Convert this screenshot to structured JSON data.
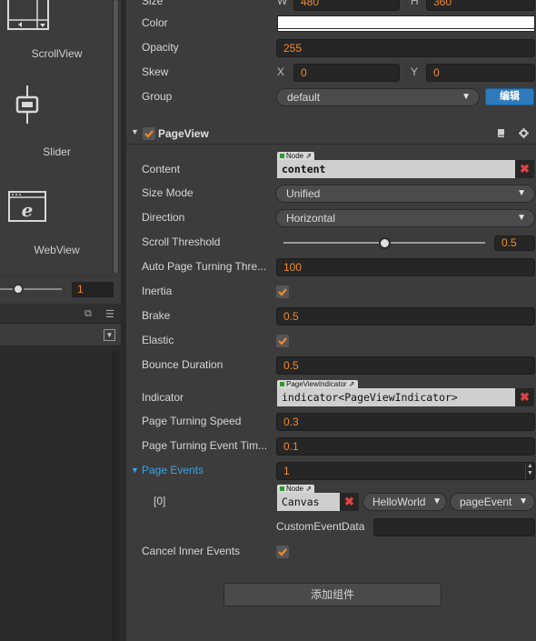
{
  "library": {
    "items": [
      {
        "label": "ScrollView",
        "icon": "scrollview-icon"
      },
      {
        "label": "Slider",
        "icon": "slider-icon"
      },
      {
        "label": "WebView",
        "icon": "webview-icon"
      }
    ],
    "zoom_value": "1"
  },
  "inspector": {
    "size": {
      "label": "Size",
      "w_label": "W",
      "h_label": "H",
      "w_value": "480",
      "h_value": "360"
    },
    "color": {
      "label": "Color",
      "value": "#ffffff"
    },
    "opacity": {
      "label": "Opacity",
      "value": "255"
    },
    "skew": {
      "label": "Skew",
      "x_label": "X",
      "x_value": "0",
      "y_label": "Y",
      "y_value": "0"
    },
    "group": {
      "label": "Group",
      "value": "default",
      "edit_label": "编辑"
    },
    "component": {
      "title": "PageView",
      "enabled": true
    },
    "content": {
      "label": "Content",
      "tag": "Node",
      "value": "content"
    },
    "size_mode": {
      "label": "Size Mode",
      "value": "Unified"
    },
    "direction": {
      "label": "Direction",
      "value": "Horizontal"
    },
    "scroll_threshold": {
      "label": "Scroll Threshold",
      "value": "0.5",
      "fraction": 0.5
    },
    "auto_page_turning": {
      "label": "Auto Page Turning Thre...",
      "value": "100"
    },
    "inertia": {
      "label": "Inertia",
      "checked": true
    },
    "brake": {
      "label": "Brake",
      "value": "0.5"
    },
    "elastic": {
      "label": "Elastic",
      "checked": true
    },
    "bounce_duration": {
      "label": "Bounce Duration",
      "value": "0.5"
    },
    "indicator": {
      "label": "Indicator",
      "tag": "PageViewIndicator",
      "value": "indicator<PageViewIndicator>"
    },
    "page_turning_speed": {
      "label": "Page Turning Speed",
      "value": "0.3"
    },
    "page_turning_event_timing": {
      "label": "Page Turning Event Tim...",
      "value": "0.1"
    },
    "page_events": {
      "label": "Page Events",
      "count": "1",
      "item_index": "[0]",
      "tag": "Node",
      "target": "Canvas",
      "component": "HelloWorld",
      "handler": "pageEvent",
      "custom_data_label": "CustomEventData",
      "custom_data_value": ""
    },
    "cancel_inner_events": {
      "label": "Cancel Inner Events",
      "checked": true
    },
    "add_component_label": "添加组件"
  },
  "colors": {
    "accent": "#f08a2e",
    "edit_button": "#2d7bbd",
    "link": "#3aa3e3",
    "remove": "#dd4444"
  }
}
